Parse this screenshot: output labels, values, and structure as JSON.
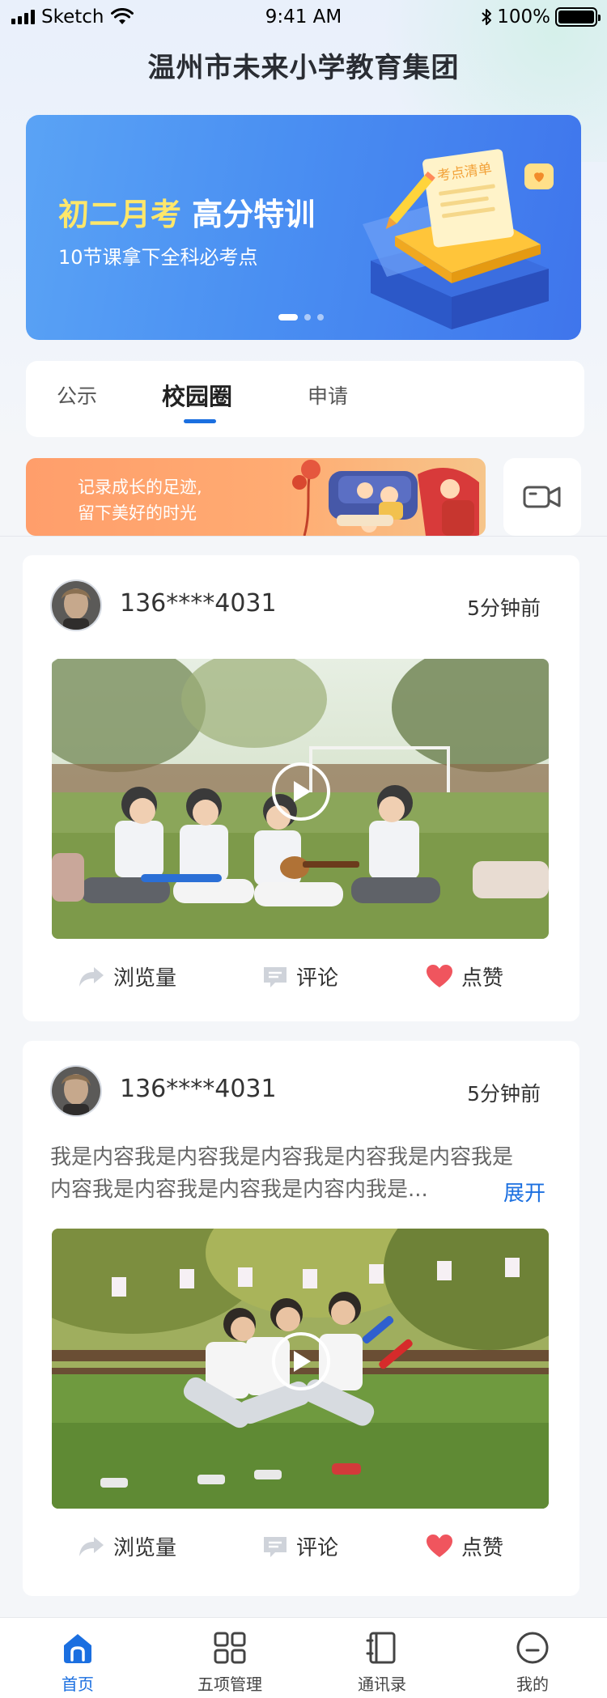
{
  "status_bar": {
    "carrier": "Sketch",
    "time": "9:41 AM",
    "battery": "100%"
  },
  "header": {
    "title": "温州市未来小学教育集团"
  },
  "banner": {
    "highlight": "初二月考",
    "headline_rest": "高分特训",
    "subline": "10节课拿下全科必考点",
    "art_label": "考点清单",
    "slides_total": 3,
    "slide_active": 1
  },
  "tabs": [
    {
      "label": "公示"
    },
    {
      "label": "校园圈"
    },
    {
      "label": "申请"
    }
  ],
  "active_tab": "校园圈",
  "promo": {
    "line1": "记录成长的足迹,",
    "line2": "留下美好的时光"
  },
  "posts": [
    {
      "user": "136****4031",
      "time": "5分钟前",
      "content": "",
      "expand": ""
    },
    {
      "user": "136****4031",
      "time": "5分钟前",
      "content": "我是内容我是内容我是内容我是内容我是内容我是内容我是内容我是内容我是内容内我是...",
      "expand": "展开"
    }
  ],
  "post_actions": {
    "views": "浏览量",
    "comment": "评论",
    "like": "点赞"
  },
  "nav": [
    {
      "label": "首页",
      "icon": "home-icon"
    },
    {
      "label": "五项管理",
      "icon": "grid-icon"
    },
    {
      "label": "通讯录",
      "icon": "contacts-icon"
    },
    {
      "label": "我的",
      "icon": "profile-icon"
    }
  ],
  "colors": {
    "accent": "#1b6fe0",
    "banner_highlight": "#ffe76a",
    "like": "#f0555e"
  }
}
